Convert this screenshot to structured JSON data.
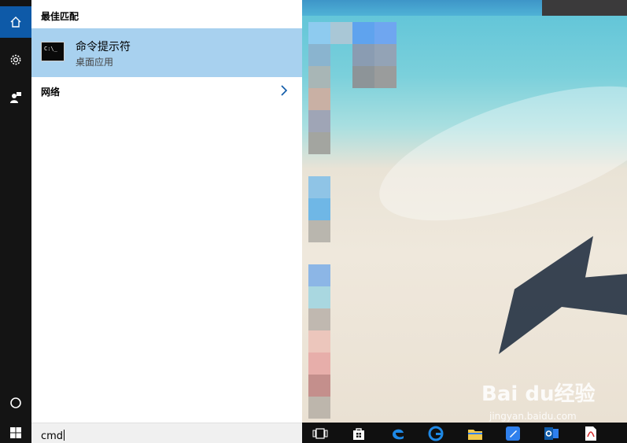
{
  "rail": {
    "home_icon": "home-icon",
    "settings_icon": "gear-icon",
    "feedback_icon": "feedback-icon",
    "cortana_icon": "cortana-circle-icon"
  },
  "results": {
    "best_match_heading": "最佳匹配",
    "best_match": {
      "name": "命令提示符",
      "subtitle": "桌面应用",
      "icon_text": "C:\\_"
    },
    "network_label": "网络"
  },
  "search": {
    "value": "cmd"
  },
  "watermark": {
    "brand": "Bai du经验",
    "url": "jingyan.baidu.com"
  },
  "taskbar": {
    "icons": [
      "task-view-icon",
      "store-icon",
      "edge-icon",
      "edge-alt-icon",
      "file-explorer-icon",
      "pen-icon",
      "outlook-icon",
      "pdf-icon"
    ]
  },
  "colors": {
    "accent": "#0e5aa8",
    "selection": "#a8d1ef",
    "rail": "#141414"
  }
}
